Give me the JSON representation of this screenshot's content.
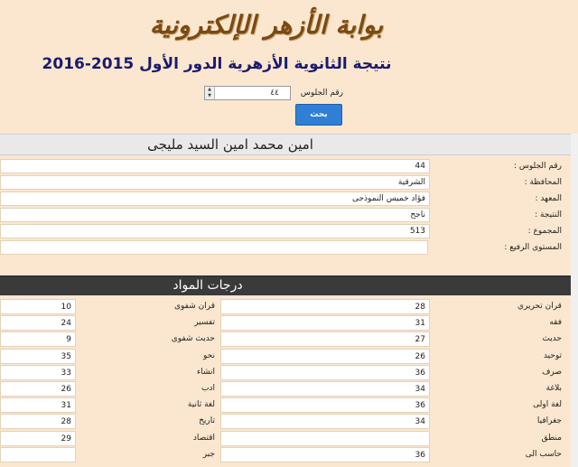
{
  "header": {
    "logo_text": "بوابة الأزهر الإلكترونية",
    "page_title": "نتيجة الثانوية الأزهرية الدور الأول 2015-2016"
  },
  "search": {
    "seat_label": "رقم الجلوس",
    "seat_value": "٤٤",
    "button_label": "بحث"
  },
  "student": {
    "name": "امين محمد امين السيد مليجى"
  },
  "info": [
    {
      "label": "رقم الجلوس :",
      "value": "44"
    },
    {
      "label": "المحافظة :",
      "value": "الشرقية"
    },
    {
      "label": "المعهد :",
      "value": "فؤاد خميس النموذجى"
    },
    {
      "label": "النتيجة :",
      "value": "ناجح"
    },
    {
      "label": "المجموع :",
      "value": "513"
    },
    {
      "label": "المستوى الرفيع :",
      "value": ""
    }
  ],
  "grades": {
    "title": "درجات المواد",
    "rows": [
      {
        "s1": "قران تحريري",
        "v1": "28",
        "s2": "قران شفوى",
        "v2": "10"
      },
      {
        "s1": "فقه",
        "v1": "31",
        "s2": "تفسير",
        "v2": "24"
      },
      {
        "s1": "حديث",
        "v1": "27",
        "s2": "حديث شفوى",
        "v2": "9"
      },
      {
        "s1": "توحيد",
        "v1": "26",
        "s2": "نحو",
        "v2": "35"
      },
      {
        "s1": "صرف",
        "v1": "36",
        "s2": "انشاء",
        "v2": "33"
      },
      {
        "s1": "بلاغة",
        "v1": "34",
        "s2": "ادب",
        "v2": "26"
      },
      {
        "s1": "لغة اولى",
        "v1": "36",
        "s2": "لغة ثانية",
        "v2": "31"
      },
      {
        "s1": "جغرافيا",
        "v1": "34",
        "s2": "تاريخ",
        "v2": "28"
      },
      {
        "s1": "منطق",
        "v1": "",
        "s2": "اقتصاد",
        "v2": "29"
      },
      {
        "s1": "حاسب الى",
        "v1": "36",
        "s2": "جبر",
        "v2": ""
      }
    ]
  }
}
